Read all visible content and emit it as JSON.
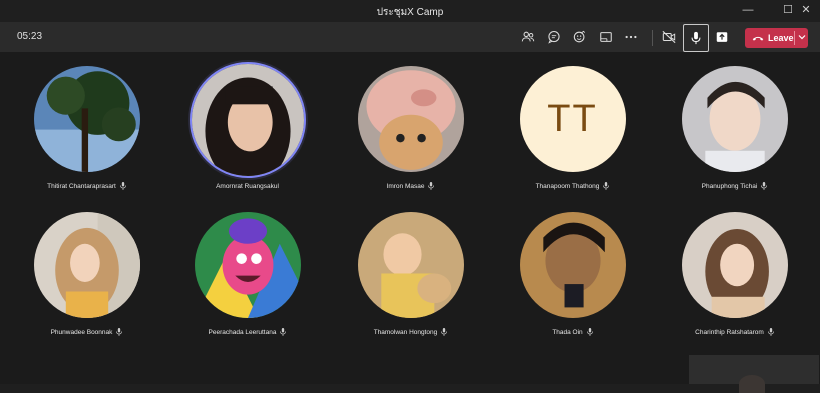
{
  "window": {
    "title": "ประชุมX Camp",
    "minimize": "—",
    "maximize": "☐",
    "close": "✕"
  },
  "toolbar": {
    "timer": "05:23",
    "icons": [
      "people-icon",
      "chat-icon",
      "reactions-icon",
      "share-tray-icon",
      "more-icon",
      "camera-off-icon",
      "mic-icon",
      "share-screen-icon"
    ],
    "leave_label": "Leave",
    "leave_color": "#c4314b"
  },
  "participants": [
    {
      "name": "Thitirat Chantaraprasart",
      "avatar": "tree-photo"
    },
    {
      "name": "Amornrat Ruangsakul",
      "avatar": "portrait-photo",
      "speaking": true
    },
    {
      "name": "Imron Masae",
      "avatar": "cat-pig-hat-photo"
    },
    {
      "name": "Thanapoom Thathong",
      "avatar": "initials",
      "initials": "TT"
    },
    {
      "name": "Phanuphong Tichai",
      "avatar": "portrait-photo"
    },
    {
      "name": "Phunwadee Boonnak",
      "avatar": "portrait-photo"
    },
    {
      "name": "Peerachada Leeruttana",
      "avatar": "troll-cartoon"
    },
    {
      "name": "Thamolwan Hongtong",
      "avatar": "baby-photo"
    },
    {
      "name": "Thada Oin",
      "avatar": "portrait-photo"
    },
    {
      "name": "Charinthip Ratshatarom",
      "avatar": "portrait-photo"
    }
  ],
  "accent_color": "#7f85f5"
}
